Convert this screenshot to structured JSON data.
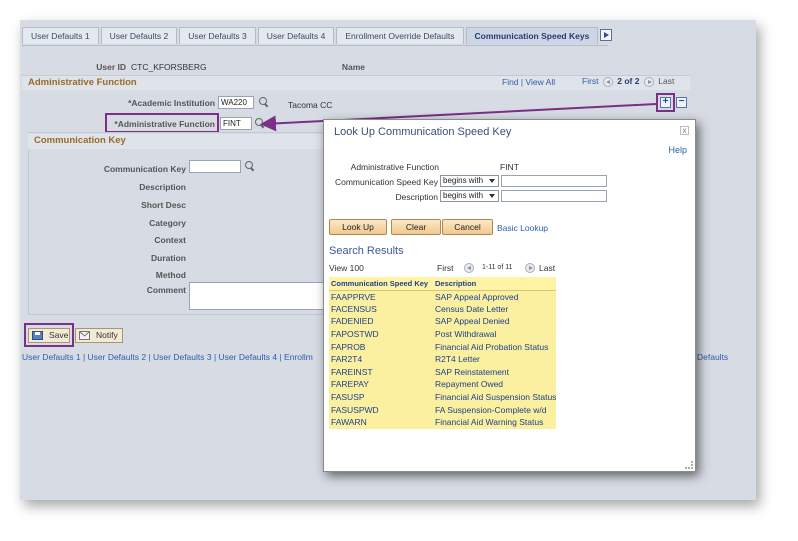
{
  "tabs": [
    {
      "label": "User Defaults 1"
    },
    {
      "label": "User Defaults 2"
    },
    {
      "label": "User Defaults 3"
    },
    {
      "label": "User Defaults 4"
    },
    {
      "label": "Enrollment Override Defaults"
    },
    {
      "label": "Communication Speed Keys"
    }
  ],
  "header": {
    "user_id_label": "User ID",
    "user_id_value": "CTC_KFORSBERG",
    "name_label": "Name"
  },
  "admin_section": {
    "title": "Administrative Function",
    "find": "Find",
    "sep": "|",
    "view_all": "View All",
    "first": "First",
    "count": "2 of 2",
    "last": "Last",
    "academic_institution_label": "*Academic Institution",
    "academic_institution_value": "WA220",
    "institution_desc": "Tacoma CC",
    "admin_function_label": "*Administrative Function",
    "admin_function_value": "FINT"
  },
  "comm_section": {
    "title": "Communication Key",
    "fields": {
      "comm_key": "Communication Key",
      "description": "Description",
      "short_desc": "Short Desc",
      "category": "Category",
      "context": "Context",
      "duration": "Duration",
      "method": "Method",
      "comment": "Comment"
    }
  },
  "actions": {
    "save": "Save",
    "notify": "Notify"
  },
  "bottom_links": "User Defaults 1 | User Defaults 2 | User Defaults 3 | User Defaults 4 | Enrollm",
  "bottom_links_tail": "Defaults",
  "modal": {
    "title": "Look Up Communication Speed Key",
    "close": "x",
    "help": "Help",
    "admin_function_label": "Administrative Function",
    "admin_function_value": "FINT",
    "speed_key_label": "Communication Speed Key",
    "speed_key_operator": "begins with",
    "description_label": "Description",
    "description_operator": "begins with",
    "lookup_btn": "Look Up",
    "clear_btn": "Clear",
    "cancel_btn": "Cancel",
    "basic_lookup": "Basic Lookup",
    "results_title": "Search Results",
    "view_100": "View 100",
    "first": "First",
    "range": "1-11 of 11",
    "last": "Last",
    "columns": [
      "Communication Speed Key",
      "Description"
    ],
    "rows": [
      [
        "FAAPPRVE",
        "SAP Appeal Approved"
      ],
      [
        "FACENSUS",
        "Census Date Letter"
      ],
      [
        "FADENIED",
        "SAP Appeal Denied"
      ],
      [
        "FAPOSTWD",
        "Post Withdrawal"
      ],
      [
        "FAPROB",
        "Financial Aid Probation Status"
      ],
      [
        "FAR2T4",
        "R2T4 Letter"
      ],
      [
        "FAREINST",
        "SAP Reinstatement"
      ],
      [
        "FAREPAY",
        "Repayment Owed"
      ],
      [
        "FASUSP",
        "Financial Aid Suspension Status"
      ],
      [
        "FASUSPWD",
        "FA Suspension-Complete w/d"
      ],
      [
        "FAWARN",
        "Financial Aid Warning Status"
      ]
    ]
  },
  "colors": {
    "highlight": "#7b2f86",
    "link": "#2f5ea8",
    "section_title": "#9a6a2a",
    "result_row": "#faf0a0"
  }
}
